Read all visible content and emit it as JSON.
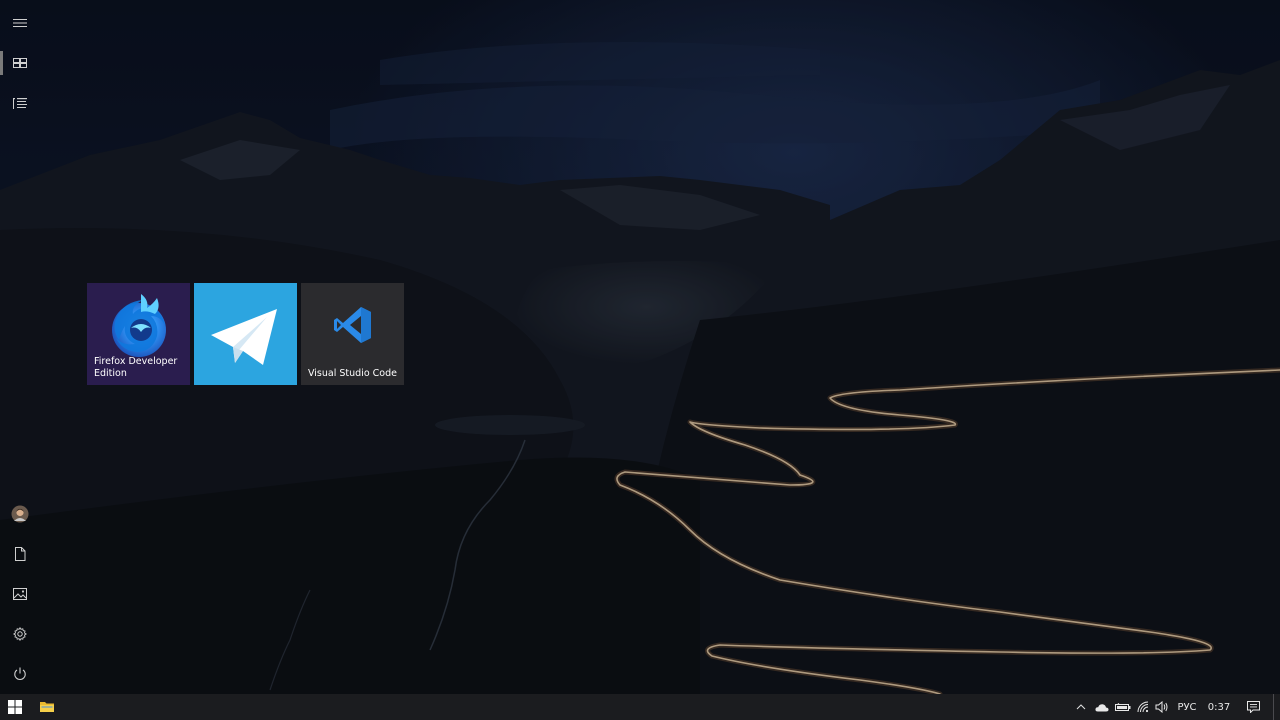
{
  "tiles": [
    {
      "id": "firefox",
      "label": "Firefox Developer Edition",
      "background": "#2a1d4e"
    },
    {
      "id": "telegram",
      "label": "",
      "background": "#2ca5e0"
    },
    {
      "id": "vscode",
      "label": "Visual Studio Code",
      "background": "#2b2b2e"
    }
  ],
  "rail": {
    "top": [
      {
        "name": "hamburger-menu-icon"
      },
      {
        "name": "tiles-view-icon",
        "active": true
      },
      {
        "name": "all-apps-list-icon"
      }
    ],
    "bottom": [
      {
        "name": "user-avatar"
      },
      {
        "name": "documents-icon"
      },
      {
        "name": "pictures-icon"
      },
      {
        "name": "settings-gear-icon"
      },
      {
        "name": "power-icon"
      }
    ]
  },
  "taskbar": {
    "pinned": [
      {
        "name": "windows-start-icon"
      },
      {
        "name": "file-explorer-icon"
      }
    ],
    "tray": {
      "icons": [
        "chevron-up-icon",
        "onedrive-cloud-icon",
        "battery-icon",
        "wifi-icon",
        "volume-icon"
      ],
      "language": "РУС",
      "time": "0:37"
    }
  },
  "colors": {
    "taskbar": "#1b1c1f",
    "firefox_tile": "#2a1d4e",
    "telegram_tile": "#2ca5e0",
    "vscode_tile": "#2b2b2e",
    "vscode_blue": "#2a8ae8",
    "accent_light_trail": "#f0d6b0"
  }
}
